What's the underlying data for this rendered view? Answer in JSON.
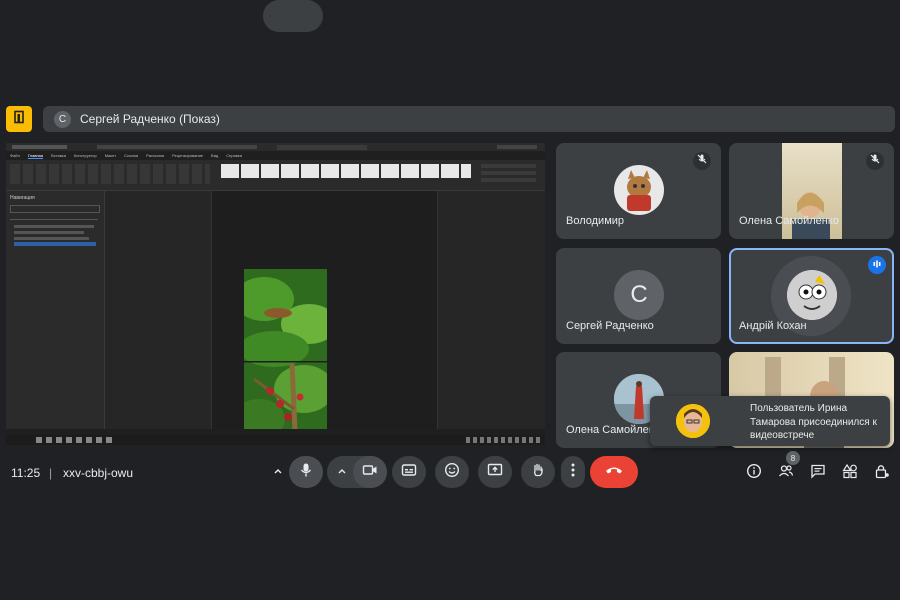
{
  "presenter": {
    "avatar_letter": "С",
    "label": "Сергей Радченко (Показ)"
  },
  "shared_screen": {
    "ribbon_tabs": [
      "Файл",
      "Главная",
      "Вставка",
      "Конструктор",
      "Макет",
      "Ссылки",
      "Рассылки",
      "Рецензирование",
      "Вид",
      "Справка"
    ],
    "nav_title": "Навигация"
  },
  "participants": [
    {
      "name": "Володимир",
      "muted": true
    },
    {
      "name": "Олена Самойленко",
      "muted": true
    },
    {
      "name": "Сергей Радченко",
      "avatar_letter": "С",
      "muted": false
    },
    {
      "name": "Андрій Кохан",
      "speaking": true
    },
    {
      "name": "Олена Самойленко"
    },
    {
      "name": ""
    }
  ],
  "toast": {
    "text": "Пользователь Ирина Тамарова присоединился к видеовстрече"
  },
  "meeting": {
    "time": "11:25",
    "separator": "|",
    "code": "xxv-cbbj-owu",
    "participants_count": "8"
  },
  "colors": {
    "accent": "#fbbc04",
    "end_call": "#ea4335",
    "speaking": "#1a73e8",
    "highlight_border": "#8ab4f8"
  },
  "icons": [
    "door-icon",
    "mic-off-icon",
    "speaking-icon",
    "chevron-up-icon",
    "mic-icon",
    "camera-icon",
    "captions-icon",
    "emoji-icon",
    "present-icon",
    "hand-icon",
    "more-icon",
    "end-call-icon",
    "info-icon",
    "people-icon",
    "chat-icon",
    "activities-icon",
    "host-controls-icon"
  ]
}
